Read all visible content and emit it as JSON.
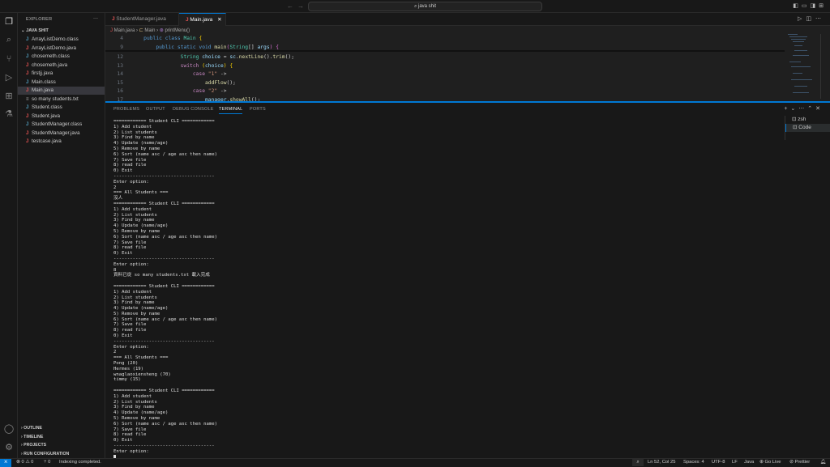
{
  "titlebar": {
    "search": "java shit",
    "back": "←",
    "forward": "→"
  },
  "sidebar": {
    "title": "EXPLORER",
    "more": "···",
    "folder": "JAVA SHIT",
    "files": [
      {
        "name": "ArrayListDemo.class",
        "type": "class"
      },
      {
        "name": "ArrayListDemo.java",
        "type": "java"
      },
      {
        "name": "chosemeth.class",
        "type": "class"
      },
      {
        "name": "chosemeth.java",
        "type": "java"
      },
      {
        "name": "firstjj.java",
        "type": "java"
      },
      {
        "name": "Main.class",
        "type": "class"
      },
      {
        "name": "Main.java",
        "type": "java",
        "selected": true
      },
      {
        "name": "so many students.txt",
        "type": "txt"
      },
      {
        "name": "Student.class",
        "type": "class"
      },
      {
        "name": "Student.java",
        "type": "java"
      },
      {
        "name": "StudentManager.class",
        "type": "class"
      },
      {
        "name": "StudentManager.java",
        "type": "java"
      },
      {
        "name": "testcase.java",
        "type": "java"
      }
    ],
    "sections": [
      "OUTLINE",
      "TIMELINE",
      "PROJECTS",
      "RUN CONFIGURATION"
    ]
  },
  "tabs": [
    {
      "label": "StudentManager.java",
      "active": false
    },
    {
      "label": "Main.java",
      "active": true
    }
  ],
  "breadcrumb": [
    "Main.java",
    "Main",
    "printMenu()"
  ],
  "code": [
    {
      "n": "4",
      "t": [
        [
          "    ",
          ""
        ],
        [
          "public class ",
          "#569cd6"
        ],
        [
          "Main ",
          "#4ec9b0"
        ],
        [
          "{",
          "#ffd700"
        ]
      ]
    },
    {
      "n": "9",
      "t": [
        [
          "        ",
          ""
        ],
        [
          "public static void ",
          "#569cd6"
        ],
        [
          "main",
          "#dcdcaa"
        ],
        [
          "(",
          "#da70d6"
        ],
        [
          "String",
          "#4ec9b0"
        ],
        [
          "[] ",
          "#ccc"
        ],
        [
          "args",
          "#9cdcfe"
        ],
        [
          ") {",
          "#da70d6"
        ]
      ]
    },
    {
      "n": "12",
      "t": [
        [
          "                ",
          ""
        ],
        [
          "String ",
          "#4ec9b0"
        ],
        [
          "choice ",
          "#9cdcfe"
        ],
        [
          "= ",
          "#ccc"
        ],
        [
          "sc",
          "#9cdcfe"
        ],
        [
          ".",
          "#ccc"
        ],
        [
          "nextLine",
          "#dcdcaa"
        ],
        [
          "().",
          "#ccc"
        ],
        [
          "trim",
          "#dcdcaa"
        ],
        [
          "();",
          "#ccc"
        ]
      ]
    },
    {
      "n": "13",
      "t": [
        [
          "                ",
          ""
        ],
        [
          "switch ",
          "#c586c0"
        ],
        [
          "(",
          "#ffd700"
        ],
        [
          "choice",
          "#9cdcfe"
        ],
        [
          ") {",
          "#ffd700"
        ]
      ]
    },
    {
      "n": "14",
      "t": [
        [
          "                    ",
          ""
        ],
        [
          "case ",
          "#c586c0"
        ],
        [
          "\"1\" ",
          "#ce9178"
        ],
        [
          "->",
          "#ccc"
        ]
      ]
    },
    {
      "n": "15",
      "t": [
        [
          "                        ",
          ""
        ],
        [
          "addFlow",
          "#dcdcaa"
        ],
        [
          "();",
          "#ccc"
        ]
      ]
    },
    {
      "n": "16",
      "t": [
        [
          "                    ",
          ""
        ],
        [
          "case ",
          "#c586c0"
        ],
        [
          "\"2\" ",
          "#ce9178"
        ],
        [
          "->",
          "#ccc"
        ]
      ]
    },
    {
      "n": "17",
      "t": [
        [
          "                        ",
          ""
        ],
        [
          "manager",
          "#9cdcfe"
        ],
        [
          ".",
          "#ccc"
        ],
        [
          "showAll",
          "#dcdcaa"
        ],
        [
          "();",
          "#ccc"
        ]
      ]
    },
    {
      "n": "18",
      "t": [
        [
          "                    ",
          ""
        ],
        [
          "case ",
          "#c586c0"
        ],
        [
          "\"3\" ",
          "#ce9178"
        ],
        [
          "->",
          "#ccc"
        ]
      ]
    }
  ],
  "panel": {
    "tabs": [
      "PROBLEMS",
      "OUTPUT",
      "DEBUG CONSOLE",
      "TERMINAL",
      "PORTS"
    ],
    "active": "TERMINAL",
    "terminals": [
      "zsh",
      "Code"
    ]
  },
  "terminal": [
    "============ Student CLI ============",
    "1) Add student",
    "2) List students",
    "3) Find by name",
    "4) Update (name/age)",
    "5) Remove by name",
    "6) Sort (name asc / age asc then name)",
    "7) Save file",
    "8) read file",
    "0) Exit",
    "-------------------------------------",
    "Enter option:",
    "2",
    "=== All Students ===",
    "沒人",
    "============ Student CLI ============",
    "1) Add student",
    "2) List students",
    "3) Find by name",
    "4) Update (name/age)",
    "5) Remove by name",
    "6) Sort (name asc / age asc then name)",
    "7) Save file",
    "8) read file",
    "0) Exit",
    "-------------------------------------",
    "Enter option:",
    "8",
    "資料已從 so many students.txt 載入完成",
    "",
    "============ Student CLI ============",
    "1) Add student",
    "2) List students",
    "3) Find by name",
    "4) Update (name/age)",
    "5) Remove by name",
    "6) Sort (name asc / age asc then name)",
    "7) Save file",
    "8) read file",
    "0) Exit",
    "-------------------------------------",
    "Enter option:",
    "2",
    "=== All Students ===",
    "Pong (20)",
    "Hermes (19)",
    "wnaglaoxiensheng (70)",
    "timmy (15)",
    "",
    "============ Student CLI ============",
    "1) Add student",
    "2) List students",
    "3) Find by name",
    "4) Update (name/age)",
    "5) Remove by name",
    "6) Sort (name asc / age asc then name)",
    "7) Save file",
    "8) read file",
    "0) Exit",
    "-------------------------------------",
    "Enter option:"
  ],
  "status": {
    "errors": "0",
    "warnings": "0",
    "ports": "0",
    "message": "Indexing completed.",
    "position": "Ln 52, Col 25",
    "spaces": "Spaces: 4",
    "encoding": "UTF-8",
    "eol": "LF",
    "language": "Java",
    "golive": "Go Live",
    "prettier": "Prettier"
  }
}
